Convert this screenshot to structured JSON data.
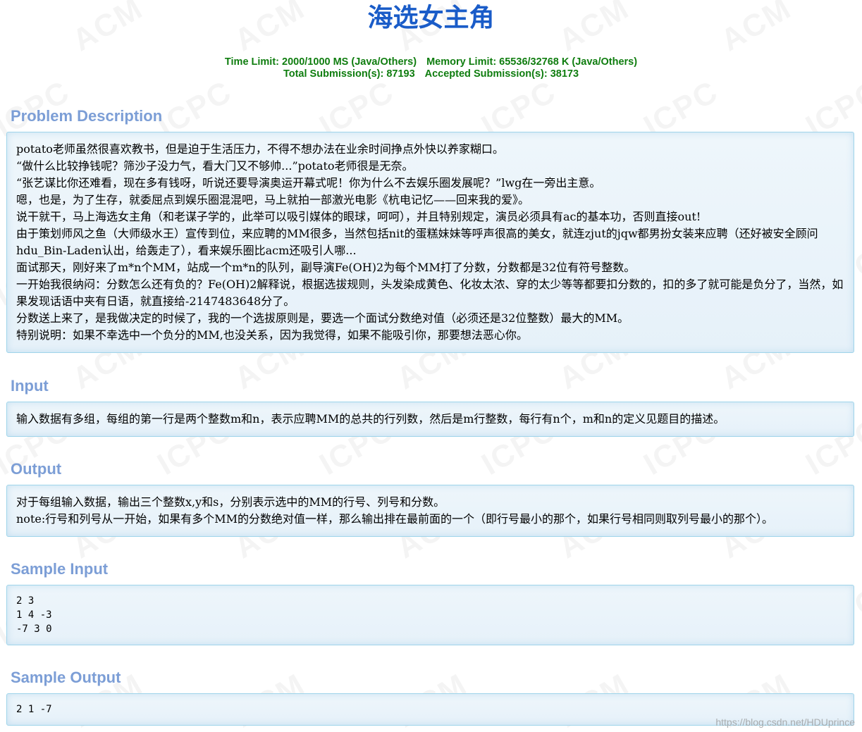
{
  "problem": {
    "title": "海选女主角",
    "time_limit": "Time Limit: 2000/1000 MS (Java/Others)",
    "memory_limit": "Memory Limit: 65536/32768 K (Java/Others)",
    "total_submissions": "Total Submission(s): 87193",
    "accepted_submissions": "Accepted Submission(s): 38173"
  },
  "sections": {
    "description": {
      "title": "Problem Description",
      "lines": [
        "potato老师虽然很喜欢教书，但是迫于生活压力，不得不想办法在业余时间挣点外快以养家糊口。",
        "“做什么比较挣钱呢？筛沙子没力气，看大门又不够帅...”potato老师很是无奈。",
        "“张艺谋比你还难看，现在多有钱呀，听说还要导演奥运开幕式呢！你为什么不去娱乐圈发展呢？”lwg在一旁出主意。",
        "嗯，也是，为了生存，就委屈点到娱乐圈混混吧，马上就拍一部激光电影《杭电记忆——回来我的爱》。",
        "说干就干，马上海选女主角（和老谋子学的，此举可以吸引媒体的眼球，呵呵），并且特别规定，演员必须具有ac的基本功，否则直接out!",
        "由于策划师风之鱼（大师级水王）宣传到位，来应聘的MM很多，当然包括nit的蛋糕妹妹等呼声很高的美女，就连zjut的jqw都男扮女装来应聘（还好被安全顾问hdu_Bin-Laden认出，给轰走了），看来娱乐圈比acm还吸引人哪...",
        "面试那天，刚好来了m*n个MM，站成一个m*n的队列，副导演Fe(OH)2为每个MM打了分数，分数都是32位有符号整数。",
        "一开始我很纳闷：分数怎么还有负的？Fe(OH)2解释说，根据选拔规则，头发染成黄色、化妆太浓、穿的太少等等都要扣分数的，扣的多了就可能是负分了，当然，如果发现话语中夹有日语，就直接给-2147483648分了。",
        "分数送上来了，是我做决定的时候了，我的一个选拔原则是，要选一个面试分数绝对值（必须还是32位整数）最大的MM。",
        "特别说明：如果不幸选中一个负分的MM,也没关系，因为我觉得，如果不能吸引你，那要想法恶心你。"
      ]
    },
    "input": {
      "title": "Input",
      "lines": [
        "输入数据有多组，每组的第一行是两个整数m和n，表示应聘MM的总共的行列数，然后是m行整数，每行有n个，m和n的定义见题目的描述。"
      ]
    },
    "output": {
      "title": "Output",
      "lines": [
        "对于每组输入数据，输出三个整数x,y和s，分别表示选中的MM的行号、列号和分数。",
        "note:行号和列号从一开始，如果有多个MM的分数绝对值一样，那么输出排在最前面的一个（即行号最小的那个，如果行号相同则取列号最小的那个）。"
      ]
    },
    "sample_input": {
      "title": "Sample Input",
      "text": "2 3\n1 4 -3\n-7 3 0"
    },
    "sample_output": {
      "title": "Sample Output",
      "text": "2 1 -7"
    }
  },
  "watermark": {
    "text_a": "ACM",
    "text_b": "ICPC"
  },
  "credit": "https://blog.csdn.net/HDUprince"
}
